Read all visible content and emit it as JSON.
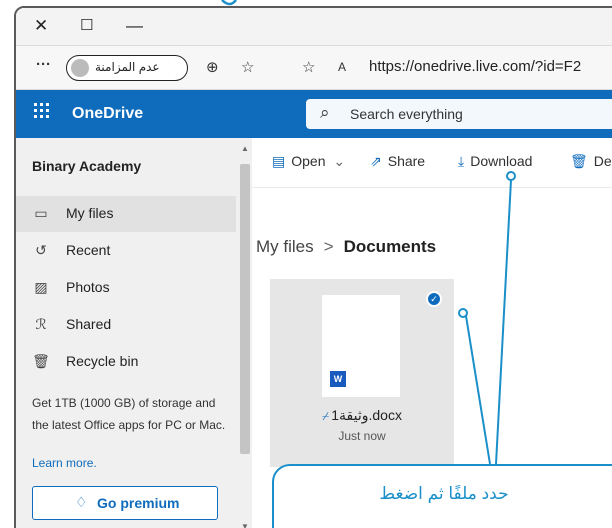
{
  "window_controls": {
    "close": "✕",
    "maximize": "☐",
    "minimize": "—"
  },
  "address_bar": {
    "more": "···",
    "profile_label": "عدم المزامنة",
    "url": "https://onedrive.live.com/?id=F2"
  },
  "app_bar": {
    "brand": "OneDrive",
    "search_placeholder": "Search everything"
  },
  "sidebar": {
    "account": "Binary Academy",
    "items": [
      {
        "label": "My files",
        "icon": "folder-icon",
        "glyph": "▭"
      },
      {
        "label": "Recent",
        "icon": "history-icon",
        "glyph": "↺"
      },
      {
        "label": "Photos",
        "icon": "photo-icon",
        "glyph": "▨"
      },
      {
        "label": "Shared",
        "icon": "shared-icon",
        "glyph": "ℛ"
      },
      {
        "label": "Recycle bin",
        "icon": "recycle-bin-icon",
        "glyph": "🗑"
      }
    ],
    "promo_text": "Get 1TB (1000 GB) of storage and the latest Office apps for PC or Mac.",
    "learn_more": "Learn more.",
    "premium_button": "Go premium"
  },
  "command_bar": {
    "open": "Open",
    "share": "Share",
    "download": "Download",
    "delete": "Del"
  },
  "breadcrumb": {
    "parent": "My files",
    "separator": ">",
    "current": "Documents"
  },
  "file": {
    "name": "وثيقة1.docx",
    "modified": "Just now",
    "type_badge": "W"
  },
  "callout": {
    "text": "حدد ملفًا ثم اضغط"
  },
  "colors": {
    "brand": "#0f6cbd",
    "callout": "#1a8fc9"
  }
}
